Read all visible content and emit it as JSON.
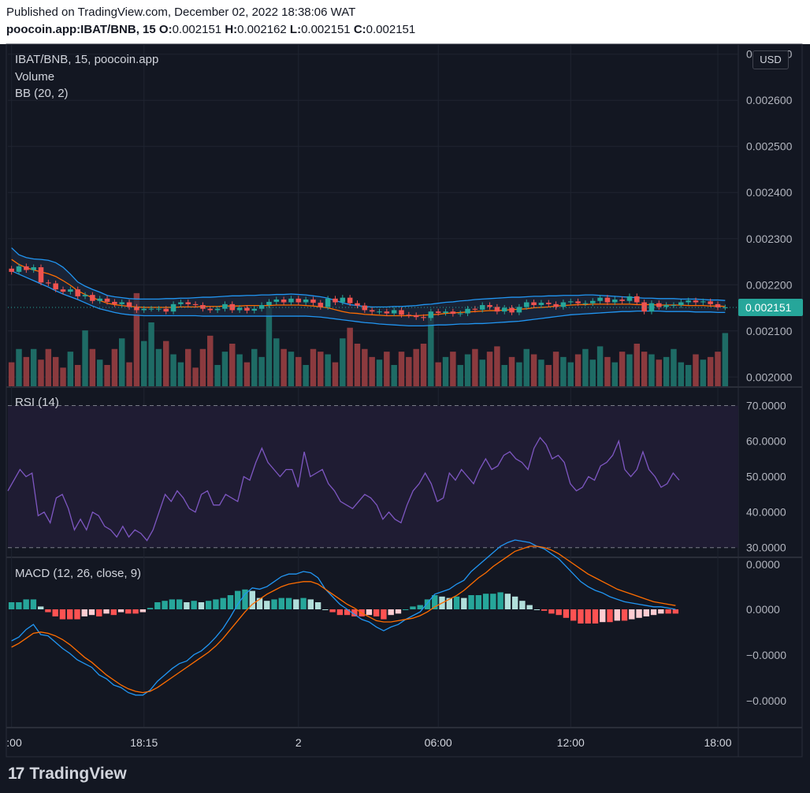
{
  "header": {
    "published": "Published on TradingView.com, December 02, 2022 18:38:06 WAT",
    "symbol": "poocoin.app:IBAT/BNB, 15",
    "o_label": "O:",
    "o_value": "0.002151",
    "h_label": "H:",
    "h_value": "0.002162",
    "l_label": "L:",
    "l_value": "0.002151",
    "c_label": "C:",
    "c_value": "0.002151"
  },
  "legend": {
    "symbol": "IBAT/BNB, 15, poocoin.app",
    "volume": "Volume",
    "bb": "BB (20, 2)",
    "rsi": "RSI (14)",
    "macd": "MACD (12, 26, close, 9)"
  },
  "currency_button": "USD",
  "footer": {
    "logo_mark": "17",
    "logo_text": "TradingView"
  },
  "colors": {
    "background": "#131722",
    "grid": "#1f2430",
    "border": "#2a2e39",
    "bull": "#26a69a",
    "bear": "#ef5350",
    "vol_bull": "#1e6b65",
    "vol_bear": "#8b3a3e",
    "bb_band": "#2196f3",
    "bb_basis": "#ff6d00",
    "bb_fill": "#1c2a3f",
    "rsi_line": "#7e57c2",
    "rsi_bg": "#1f1c33",
    "macd_line": "#2196f3",
    "signal_line": "#ff6d00",
    "hist_up_strong": "#26a69a",
    "hist_up_weak": "#b2dfdb",
    "hist_down_strong": "#ff5252",
    "hist_down_weak": "#ffcdd2",
    "last_price_tag": "#26a69a"
  },
  "chart_data": [
    {
      "type": "candlestick",
      "title": "IBAT/BNB, 15, poocoin.app",
      "y_ticks": [
        "0.002700",
        "0.002600",
        "0.002500",
        "0.002400",
        "0.002300",
        "0.002200",
        "0.002100",
        "0.002000"
      ],
      "ylim": [
        0.00198,
        0.00272
      ],
      "last_price": "0.002151",
      "x_ticks": [
        ":00",
        "18:15",
        "2",
        "06:00",
        "12:00",
        "18:00"
      ],
      "x_tick_index": [
        0,
        18,
        39,
        58,
        76,
        96
      ],
      "open": [
        0.002235,
        0.002228,
        0.00224,
        0.002232,
        0.002238,
        0.002205,
        0.002203,
        0.00219,
        0.002185,
        0.00219,
        0.002175,
        0.002178,
        0.002165,
        0.00217,
        0.002163,
        0.002158,
        0.002162,
        0.002152,
        0.002145,
        0.002148,
        0.002148,
        0.002148,
        0.002142,
        0.002158,
        0.002162,
        0.002158,
        0.002156,
        0.002148,
        0.002145,
        0.002148,
        0.002158,
        0.002145,
        0.00215,
        0.002144,
        0.002148,
        0.002156,
        0.002163,
        0.002168,
        0.002162,
        0.00217,
        0.002162,
        0.002168,
        0.002161,
        0.002152,
        0.00217,
        0.002162,
        0.002172,
        0.00216,
        0.002155,
        0.002145,
        0.002142,
        0.002142,
        0.002138,
        0.002145,
        0.002135,
        0.002134,
        0.00213,
        0.002128,
        0.002142,
        0.002139,
        0.002142,
        0.002137,
        0.002138,
        0.002148,
        0.002146,
        0.002156,
        0.002152,
        0.002142,
        0.00215,
        0.00214,
        0.002152,
        0.002162,
        0.002156,
        0.002161,
        0.002158,
        0.002152,
        0.002162,
        0.002164,
        0.00216,
        0.00216,
        0.002165,
        0.002172,
        0.002162,
        0.002168,
        0.002165,
        0.002175,
        0.002162,
        0.002142,
        0.00216,
        0.002152,
        0.002156,
        0.002156,
        0.002162,
        0.002166,
        0.002162,
        0.002164,
        0.002158,
        0.002151
      ],
      "close": [
        0.002228,
        0.00224,
        0.002232,
        0.002238,
        0.002205,
        0.002203,
        0.00219,
        0.002185,
        0.00219,
        0.002175,
        0.002178,
        0.002165,
        0.00217,
        0.002163,
        0.002158,
        0.002162,
        0.002152,
        0.002145,
        0.002148,
        0.002148,
        0.002148,
        0.002142,
        0.002158,
        0.002162,
        0.002158,
        0.002156,
        0.002148,
        0.002145,
        0.002148,
        0.002158,
        0.002145,
        0.00215,
        0.002144,
        0.002148,
        0.002156,
        0.002163,
        0.002168,
        0.002162,
        0.00217,
        0.002162,
        0.002168,
        0.002161,
        0.002152,
        0.00217,
        0.002162,
        0.002172,
        0.00216,
        0.002155,
        0.002145,
        0.002142,
        0.002142,
        0.002138,
        0.002145,
        0.002135,
        0.002134,
        0.00213,
        0.002128,
        0.002142,
        0.002139,
        0.002142,
        0.002137,
        0.002138,
        0.002148,
        0.002146,
        0.002156,
        0.002152,
        0.002142,
        0.00215,
        0.00214,
        0.002152,
        0.002162,
        0.002156,
        0.002161,
        0.002158,
        0.002152,
        0.002162,
        0.002164,
        0.00216,
        0.00216,
        0.002165,
        0.002172,
        0.002162,
        0.002168,
        0.002165,
        0.002175,
        0.002162,
        0.002142,
        0.00216,
        0.002152,
        0.002156,
        0.002156,
        0.002162,
        0.002166,
        0.002162,
        0.002164,
        0.002158,
        0.002151,
        0.002151
      ],
      "bb_upper": [
        0.00228,
        0.002265,
        0.002259,
        0.002256,
        0.002255,
        0.002253,
        0.002248,
        0.002238,
        0.002223,
        0.002206,
        0.002197,
        0.00219,
        0.002184,
        0.002177,
        0.002174,
        0.002172,
        0.00217,
        0.002169,
        0.002169,
        0.002169,
        0.002169,
        0.00217,
        0.00217,
        0.002171,
        0.002171,
        0.002172,
        0.002173,
        0.002173,
        0.002174,
        0.002175,
        0.002176,
        0.002176,
        0.002177,
        0.002177,
        0.002178,
        0.002178,
        0.002179,
        0.002179,
        0.00218,
        0.002179,
        0.002178,
        0.002176,
        0.002174,
        0.002171,
        0.002166,
        0.002161,
        0.002157,
        0.002155,
        0.002153,
        0.002152,
        0.002152,
        0.002152,
        0.002153,
        0.002153,
        0.002154,
        0.002155,
        0.002157,
        0.002158,
        0.00216,
        0.002162,
        0.002163,
        0.002165,
        0.002166,
        0.002168,
        0.002169,
        0.00217,
        0.002171,
        0.002172,
        0.002173,
        0.002173,
        0.002174,
        0.002175,
        0.002175,
        0.002176,
        0.002176,
        0.002177,
        0.002177,
        0.002177,
        0.002178,
        0.002178,
        0.002177,
        0.002176,
        0.002175,
        0.002174,
        0.002173,
        0.002172,
        0.002171,
        0.002171,
        0.00217,
        0.00217,
        0.00217,
        0.002169,
        0.002169,
        0.002169,
        0.002168,
        0.002167,
        0.002167,
        0.002166
      ],
      "bb_lower": [
        0.00223,
        0.002223,
        0.002216,
        0.002209,
        0.002202,
        0.002195,
        0.002187,
        0.00218,
        0.002174,
        0.002168,
        0.002161,
        0.002154,
        0.002148,
        0.002144,
        0.00214,
        0.002137,
        0.002135,
        0.002134,
        0.002133,
        0.002133,
        0.002133,
        0.002133,
        0.002133,
        0.002133,
        0.002133,
        0.002133,
        0.002132,
        0.002132,
        0.002132,
        0.002132,
        0.002132,
        0.002132,
        0.002132,
        0.002132,
        0.002132,
        0.002132,
        0.002132,
        0.002132,
        0.002132,
        0.002132,
        0.002132,
        0.002131,
        0.00213,
        0.002128,
        0.002126,
        0.002124,
        0.002122,
        0.00212,
        0.002118,
        0.002117,
        0.002115,
        0.002114,
        0.002113,
        0.002112,
        0.002111,
        0.002111,
        0.002111,
        0.002112,
        0.002113,
        0.002113,
        0.002114,
        0.002115,
        0.002115,
        0.002116,
        0.002116,
        0.002117,
        0.002118,
        0.002119,
        0.00212,
        0.002121,
        0.002123,
        0.002125,
        0.002127,
        0.002129,
        0.002131,
        0.002133,
        0.002135,
        0.002136,
        0.002137,
        0.002138,
        0.002139,
        0.00214,
        0.002141,
        0.002142,
        0.002142,
        0.002143,
        0.002143,
        0.002143,
        0.002143,
        0.002142,
        0.002142,
        0.002142,
        0.002142,
        0.002141,
        0.002141,
        0.002141,
        0.00214,
        0.00214
      ],
      "bb_basis": [
        0.002255,
        0.002244,
        0.002237,
        0.002232,
        0.002228,
        0.002224,
        0.002218,
        0.002209,
        0.002199,
        0.002187,
        0.002179,
        0.002172,
        0.002166,
        0.00216,
        0.002157,
        0.002155,
        0.002153,
        0.002152,
        0.002151,
        0.002151,
        0.002151,
        0.002151,
        0.002151,
        0.002152,
        0.002152,
        0.002152,
        0.002153,
        0.002153,
        0.002153,
        0.002154,
        0.002154,
        0.002154,
        0.002155,
        0.002155,
        0.002155,
        0.002155,
        0.002156,
        0.002156,
        0.002156,
        0.002156,
        0.002155,
        0.002154,
        0.002152,
        0.00215,
        0.002146,
        0.002142,
        0.002139,
        0.002138,
        0.002136,
        0.002135,
        0.002134,
        0.002133,
        0.002133,
        0.002133,
        0.002133,
        0.002133,
        0.002134,
        0.002135,
        0.002136,
        0.002138,
        0.002139,
        0.00214,
        0.002141,
        0.002142,
        0.002143,
        0.002144,
        0.002144,
        0.002145,
        0.002146,
        0.002147,
        0.002148,
        0.00215,
        0.002151,
        0.002152,
        0.002154,
        0.002155,
        0.002156,
        0.002157,
        0.002157,
        0.002158,
        0.002158,
        0.002158,
        0.002158,
        0.002158,
        0.002158,
        0.002157,
        0.002157,
        0.002157,
        0.002156,
        0.002156,
        0.002156,
        0.002156,
        0.002155,
        0.002155,
        0.002155,
        0.002154,
        0.002154,
        0.002153
      ],
      "volume": [
        9,
        14,
        11,
        14,
        10,
        14,
        11,
        7,
        13,
        8,
        21,
        14,
        10,
        8,
        14,
        18,
        9,
        35,
        17,
        24,
        14,
        17,
        12,
        9,
        14,
        7,
        14,
        19,
        8,
        13,
        16,
        12,
        9,
        14,
        11,
        30,
        18,
        14,
        13,
        11,
        8,
        14,
        13,
        12,
        9,
        18,
        22,
        16,
        14,
        11,
        10,
        13,
        8,
        13,
        11,
        14,
        16,
        27,
        9,
        11,
        13,
        8,
        12,
        14,
        10,
        13,
        15,
        8,
        11,
        9,
        14,
        12,
        10,
        8,
        13,
        11,
        9,
        12,
        14,
        10,
        15,
        11,
        9,
        13,
        12,
        16,
        13,
        12,
        10,
        11,
        14,
        9,
        8,
        12,
        10,
        11,
        13,
        20
      ],
      "volume_labels_note": ""
    },
    {
      "type": "line",
      "title": "RSI (14)",
      "y_ticks": [
        "70.0000",
        "60.0000",
        "50.0000",
        "40.0000",
        "30.0000"
      ],
      "ylim": [
        27.5,
        75
      ],
      "band": [
        30,
        70
      ],
      "values": [
        46,
        49,
        52,
        50,
        51,
        39,
        40,
        37,
        44,
        45,
        41,
        35,
        38,
        35,
        40,
        39,
        36,
        35,
        33,
        36,
        33,
        35,
        34,
        32,
        35,
        40,
        45,
        43,
        46,
        44,
        41,
        40,
        45,
        46,
        42,
        42,
        45,
        44,
        43,
        50,
        49,
        54,
        58,
        54,
        52,
        50,
        52,
        52,
        47,
        57,
        50,
        51,
        52,
        48,
        46,
        43,
        42,
        41,
        43,
        45,
        44,
        42,
        38,
        40,
        38,
        37,
        42,
        46,
        48,
        51,
        48,
        43,
        44,
        51,
        49,
        52,
        50,
        48,
        52,
        55,
        52,
        53,
        56,
        57,
        55,
        54,
        52,
        58,
        61,
        59,
        55,
        56,
        54,
        48,
        46,
        47,
        50,
        49,
        53,
        54,
        56,
        60,
        52,
        50,
        52,
        57,
        52,
        50,
        47,
        48,
        51,
        49
      ]
    },
    {
      "type": "line",
      "title": "MACD (12, 26, close, 9)",
      "y_ticks": [
        "0.0000",
        "0.0000",
        "−0.0000",
        "−0.0000"
      ],
      "ylim": [
        -1.0,
        0.65
      ],
      "macd": [
        -0.25,
        -0.22,
        -0.16,
        -0.12,
        -0.2,
        -0.21,
        -0.26,
        -0.31,
        -0.35,
        -0.4,
        -0.43,
        -0.46,
        -0.52,
        -0.55,
        -0.6,
        -0.62,
        -0.66,
        -0.68,
        -0.68,
        -0.64,
        -0.57,
        -0.52,
        -0.47,
        -0.43,
        -0.41,
        -0.36,
        -0.33,
        -0.28,
        -0.22,
        -0.15,
        -0.06,
        0.04,
        0.12,
        0.17,
        0.16,
        0.18,
        0.22,
        0.26,
        0.28,
        0.28,
        0.3,
        0.29,
        0.25,
        0.16,
        0.1,
        0.04,
        0.0,
        -0.04,
        -0.08,
        -0.1,
        -0.14,
        -0.17,
        -0.14,
        -0.12,
        -0.08,
        -0.05,
        -0.02,
        0.05,
        0.12,
        0.14,
        0.16,
        0.2,
        0.23,
        0.3,
        0.35,
        0.4,
        0.45,
        0.5,
        0.53,
        0.55,
        0.54,
        0.53,
        0.5,
        0.48,
        0.44,
        0.4,
        0.34,
        0.28,
        0.22,
        0.18,
        0.15,
        0.13,
        0.1,
        0.08,
        0.06,
        0.05,
        0.04,
        0.03,
        0.02,
        0.02,
        0.01,
        0.0
      ],
      "signal": [
        -0.3,
        -0.27,
        -0.23,
        -0.19,
        -0.18,
        -0.19,
        -0.21,
        -0.24,
        -0.28,
        -0.33,
        -0.38,
        -0.42,
        -0.47,
        -0.52,
        -0.56,
        -0.6,
        -0.63,
        -0.65,
        -0.66,
        -0.65,
        -0.62,
        -0.58,
        -0.54,
        -0.5,
        -0.46,
        -0.42,
        -0.38,
        -0.34,
        -0.29,
        -0.23,
        -0.16,
        -0.09,
        -0.02,
        0.04,
        0.08,
        0.12,
        0.15,
        0.18,
        0.2,
        0.21,
        0.22,
        0.22,
        0.2,
        0.16,
        0.12,
        0.08,
        0.04,
        0.01,
        -0.03,
        -0.06,
        -0.09,
        -0.1,
        -0.1,
        -0.09,
        -0.08,
        -0.07,
        -0.05,
        -0.02,
        0.02,
        0.05,
        0.08,
        0.11,
        0.15,
        0.2,
        0.25,
        0.29,
        0.34,
        0.38,
        0.42,
        0.46,
        0.48,
        0.5,
        0.5,
        0.49,
        0.47,
        0.44,
        0.4,
        0.36,
        0.32,
        0.28,
        0.25,
        0.22,
        0.19,
        0.16,
        0.14,
        0.12,
        0.1,
        0.08,
        0.06,
        0.05,
        0.04,
        0.03
      ],
      "histogram": [
        0.05,
        0.05,
        0.07,
        0.07,
        0.02,
        -0.02,
        -0.05,
        -0.07,
        -0.07,
        -0.07,
        -0.05,
        -0.04,
        -0.05,
        -0.03,
        -0.04,
        -0.02,
        -0.03,
        -0.03,
        -0.02,
        0.01,
        0.05,
        0.06,
        0.07,
        0.07,
        0.05,
        0.06,
        0.05,
        0.06,
        0.07,
        0.08,
        0.1,
        0.13,
        0.14,
        0.13,
        0.08,
        0.06,
        0.07,
        0.08,
        0.08,
        0.07,
        0.08,
        0.07,
        0.05,
        0.0,
        -0.02,
        -0.04,
        -0.04,
        -0.05,
        -0.05,
        -0.04,
        -0.05,
        -0.07,
        -0.04,
        -0.03,
        0.0,
        0.02,
        0.03,
        0.07,
        0.1,
        0.09,
        0.08,
        0.09,
        0.08,
        0.1,
        0.1,
        0.11,
        0.11,
        0.12,
        0.11,
        0.09,
        0.06,
        0.03,
        0.0,
        -0.01,
        -0.03,
        -0.04,
        -0.06,
        -0.08,
        -0.1,
        -0.1,
        -0.1,
        -0.09,
        -0.09,
        -0.08,
        -0.08,
        -0.07,
        -0.06,
        -0.05,
        -0.04,
        -0.03,
        -0.03,
        -0.03
      ]
    }
  ]
}
